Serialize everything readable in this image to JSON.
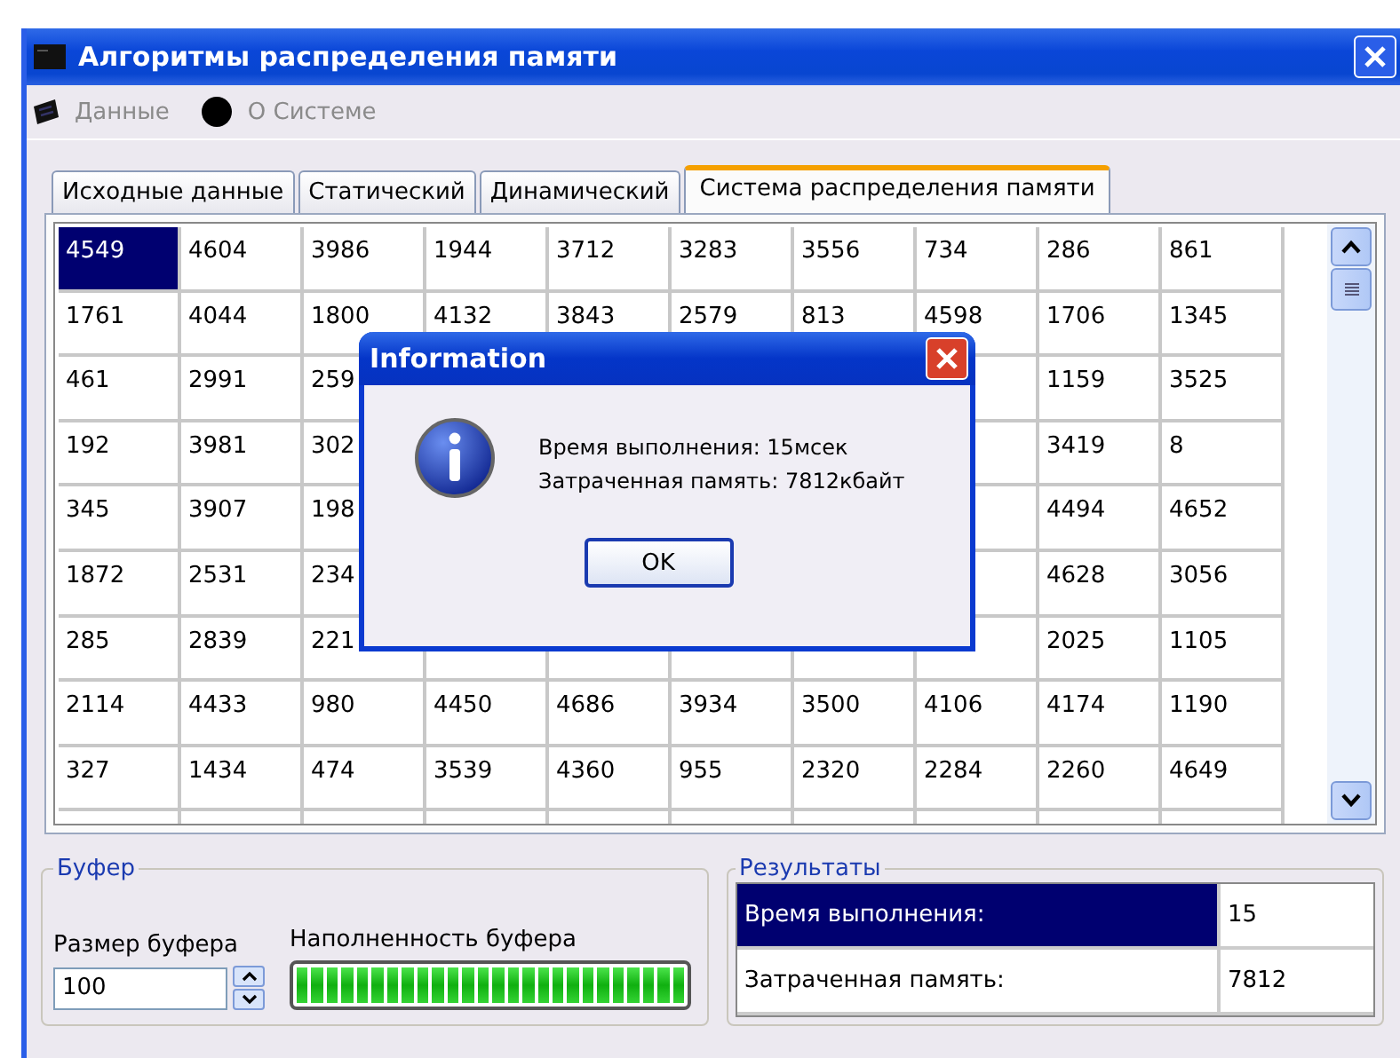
{
  "window": {
    "title": "Алгоритмы распределения памяти"
  },
  "menu": [
    {
      "label": "Данные",
      "kind": "data"
    },
    {
      "label": "О Системе",
      "kind": "about"
    }
  ],
  "tabs": [
    {
      "label": "Исходные данные",
      "selected": false
    },
    {
      "label": "Статический",
      "selected": false
    },
    {
      "label": "Динамический",
      "selected": false
    },
    {
      "label": "Система распределения памяти",
      "selected": true
    }
  ],
  "grid": {
    "rows": [
      [
        {
          "text": "4549",
          "selected": true
        },
        {
          "text": "4604",
          "selected": false
        },
        {
          "text": "3986",
          "selected": false
        },
        {
          "text": "1944",
          "selected": false
        },
        {
          "text": "3712",
          "selected": false
        },
        {
          "text": "3283",
          "selected": false
        },
        {
          "text": "3556",
          "selected": false
        },
        {
          "text": "734",
          "selected": false
        },
        {
          "text": "286",
          "selected": false
        },
        {
          "text": "861",
          "selected": false
        }
      ],
      [
        {
          "text": "1761",
          "selected": false
        },
        {
          "text": "4044",
          "selected": false
        },
        {
          "text": "1800",
          "selected": false
        },
        {
          "text": "4132",
          "selected": false
        },
        {
          "text": "3843",
          "selected": false
        },
        {
          "text": "2579",
          "selected": false
        },
        {
          "text": "813",
          "selected": false
        },
        {
          "text": "4598",
          "selected": false
        },
        {
          "text": "1706",
          "selected": false
        },
        {
          "text": "1345",
          "selected": false
        }
      ],
      [
        {
          "text": "461",
          "selected": false
        },
        {
          "text": "2991",
          "selected": false
        },
        {
          "text": "259",
          "selected": false
        },
        null,
        null,
        null,
        null,
        null,
        {
          "text": "1159",
          "selected": false
        },
        {
          "text": "3525",
          "selected": false
        }
      ],
      [
        {
          "text": "192",
          "selected": false
        },
        {
          "text": "3981",
          "selected": false
        },
        {
          "text": "302",
          "selected": false
        },
        null,
        null,
        null,
        null,
        null,
        {
          "text": "3419",
          "selected": false
        },
        {
          "text": "8",
          "selected": false
        }
      ],
      [
        {
          "text": "345",
          "selected": false
        },
        {
          "text": "3907",
          "selected": false
        },
        {
          "text": "198",
          "selected": false
        },
        null,
        null,
        null,
        null,
        null,
        {
          "text": "4494",
          "selected": false
        },
        {
          "text": "4652",
          "selected": false
        }
      ],
      [
        {
          "text": "1872",
          "selected": false
        },
        {
          "text": "2531",
          "selected": false
        },
        {
          "text": "234",
          "selected": false
        },
        null,
        null,
        null,
        null,
        null,
        {
          "text": "4628",
          "selected": false
        },
        {
          "text": "3056",
          "selected": false
        }
      ],
      [
        {
          "text": "285",
          "selected": false
        },
        {
          "text": "2839",
          "selected": false
        },
        {
          "text": "221",
          "selected": false
        },
        null,
        null,
        null,
        null,
        null,
        {
          "text": "2025",
          "selected": false
        },
        {
          "text": "1105",
          "selected": false
        }
      ],
      [
        {
          "text": "2114",
          "selected": false
        },
        {
          "text": "4433",
          "selected": false
        },
        {
          "text": "980",
          "selected": false
        },
        {
          "text": "4450",
          "selected": false
        },
        {
          "text": "4686",
          "selected": false
        },
        {
          "text": "3934",
          "selected": false
        },
        {
          "text": "3500",
          "selected": false
        },
        {
          "text": "4106",
          "selected": false
        },
        {
          "text": "4174",
          "selected": false
        },
        {
          "text": "1190",
          "selected": false
        }
      ],
      [
        {
          "text": "327",
          "selected": false
        },
        {
          "text": "1434",
          "selected": false
        },
        {
          "text": "474",
          "selected": false
        },
        {
          "text": "3539",
          "selected": false
        },
        {
          "text": "4360",
          "selected": false
        },
        {
          "text": "955",
          "selected": false
        },
        {
          "text": "2320",
          "selected": false
        },
        {
          "text": "2284",
          "selected": false
        },
        {
          "text": "2260",
          "selected": false
        },
        {
          "text": "4649",
          "selected": false
        }
      ]
    ]
  },
  "buffer": {
    "title": "Буфер",
    "size_label": "Размер буфера",
    "size_value": "100",
    "fill_label": "Наполненность буфера",
    "level": 1.0
  },
  "results": {
    "title": "Результаты",
    "rows": [
      {
        "label": "Время выполнения:",
        "value": "15",
        "selected": true
      },
      {
        "label": "Затраченная память:",
        "value": "7812",
        "selected": false
      }
    ]
  },
  "dialog": {
    "title": "Information",
    "lines": [
      "Время выполнения: 15мсек",
      "Затраченная память: 7812кбайт"
    ],
    "button": "OK"
  }
}
